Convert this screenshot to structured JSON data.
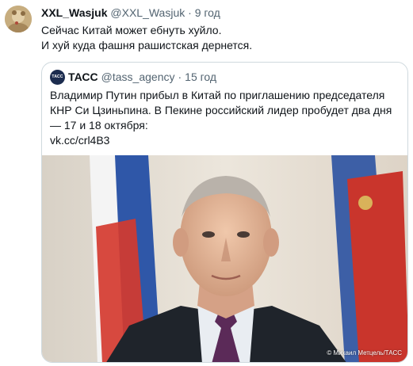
{
  "tweet": {
    "author_name": "XXL_Wasjuk",
    "author_handle": "@XXL_Wasjuk",
    "separator": "·",
    "time": "9 год",
    "text_lines": [
      "Сейчас Китай может ебнуть хуйло.",
      "И хуй куда фашня рашистская дернется."
    ]
  },
  "quote": {
    "logo_text": "ТАСС",
    "author_name": "ТАСС",
    "author_handle": "@tass_agency",
    "separator": "·",
    "time": "15 год",
    "text_lines": [
      "Владимир Путин прибыл в Китай по приглашению председателя",
      "КНР Си Цзиньпина. В Пекине российский лидер пробудет два дня",
      "— 17 и 18 октября:",
      "vk.cc/crl4B3"
    ],
    "image_credit": "© Михаил Метцель/ТАСС"
  }
}
